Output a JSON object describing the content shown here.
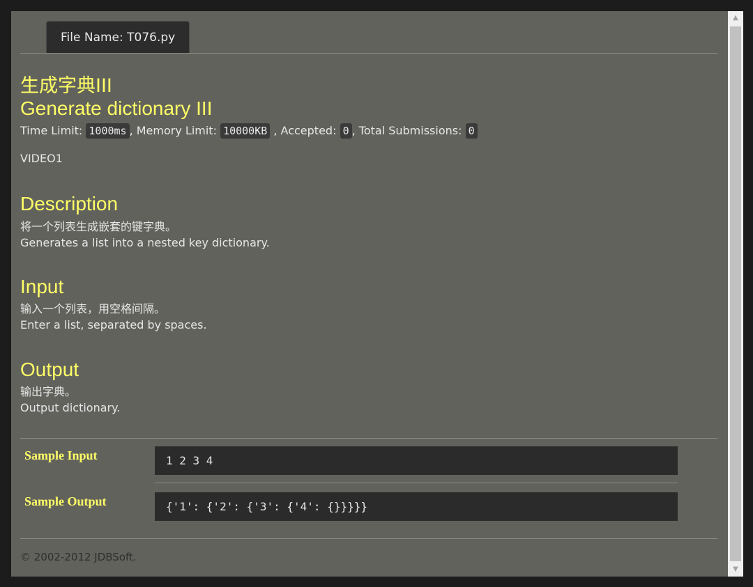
{
  "tab": {
    "label": "File Name: T076.py"
  },
  "problem": {
    "title_zh": "生成字典III",
    "title_en": "Generate dictionary III",
    "meta": {
      "time_limit_label": "Time Limit:",
      "time_limit": "1000ms",
      "memory_limit_label": ", Memory Limit:",
      "memory_limit": "10000KB",
      "accepted_label": ", Accepted:",
      "accepted": "0",
      "total_label": ", Total Submissions:",
      "total": "0"
    },
    "video": "VIDEO1",
    "description": {
      "heading": "Description",
      "zh": "将一个列表生成嵌套的键字典。",
      "en": "Generates a list into a nested key dictionary."
    },
    "input": {
      "heading": "Input",
      "zh": "输入一个列表，用空格间隔。",
      "en": "Enter a list, separated by spaces."
    },
    "output": {
      "heading": "Output",
      "zh": "输出字典。",
      "en": "Output dictionary."
    }
  },
  "samples": {
    "input_label": "Sample Input",
    "input_value": "1 2 3 4",
    "output_label": "Sample Output",
    "output_value": "{'1': {'2': {'3': {'4': {}}}}}"
  },
  "footer": {
    "text": "© 2002-2012 JDBSoft."
  },
  "colors": {
    "heading": "#ffff66",
    "background": "#62625d",
    "code_bg": "#2b2b2b"
  },
  "icons": {
    "scroll_up": "triangle-up-icon",
    "scroll_down": "triangle-down-icon"
  }
}
